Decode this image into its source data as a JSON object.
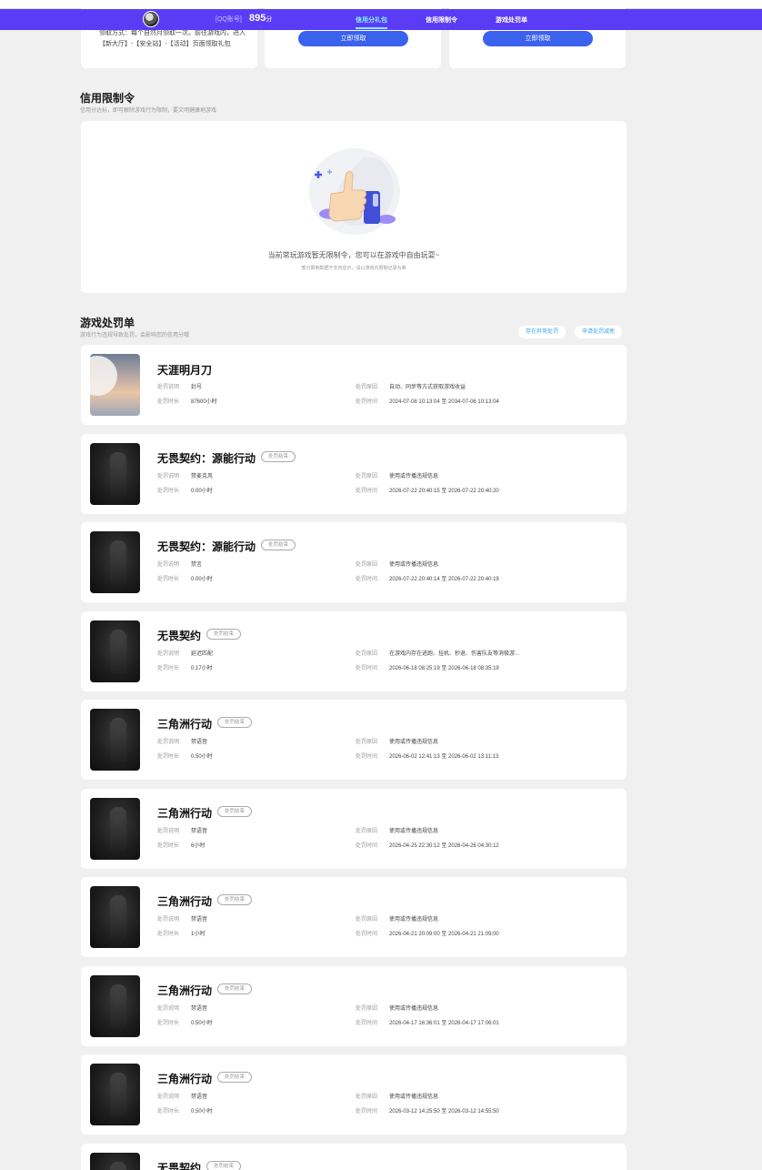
{
  "header": {
    "account_label": "[QQ账号]",
    "score_value": "895",
    "score_unit": "分",
    "nav": [
      "信用分礼包",
      "信用限制令",
      "游戏处罚单"
    ]
  },
  "gift": {
    "method_text": "领取方式：每个自然月领取一次。前往游戏内，进入【新大厅】-【安全站】-【活动】页面领取礼包",
    "buttons": [
      "立即领取",
      "立即领取"
    ]
  },
  "restriction": {
    "title": "信用限制令",
    "subtitle": "信用分达标，即可解除游戏行为限制，要文明健康地游戏",
    "empty_message": "当前常玩游戏暂无限制令，您可以在游戏中自由玩耍~",
    "empty_note": "部分限制数据不支持显示，请以游戏内限制记录为准"
  },
  "penalty": {
    "title": "游戏处罚单",
    "subtitle": "游戏行为违规导致处罚，会影响您的信用分哦",
    "links": [
      "存在异常处罚",
      "申请处罚减免"
    ],
    "field_labels": {
      "desc": "处罚说明",
      "duration": "处罚时长",
      "reason": "处罚原因",
      "time": "处罚时间"
    },
    "items": [
      {
        "game": "天涯明月刀",
        "badge": "",
        "desc": "封号",
        "duration": "87600小时",
        "reason": "自动、同步等方式获取游戏收益",
        "time": "2024-07-08 10:13:04 至 2034-07-06 10:13:04"
      },
      {
        "game": "无畏契约：源能行动",
        "badge": "处罚结束",
        "desc": "禁麦克风",
        "duration": "0.00小时",
        "reason": "使用或传播违规信息",
        "time": "2026-07-22 20:40:15 至 2026-07-22 20:40:20"
      },
      {
        "game": "无畏契约：源能行动",
        "badge": "处罚结束",
        "desc": "禁言",
        "duration": "0.00小时",
        "reason": "使用或传播违规信息",
        "time": "2026-07-22 20:40:14 至 2026-07-22 20:40:19"
      },
      {
        "game": "无畏契约",
        "badge": "处罚结束",
        "desc": "延迟匹配",
        "duration": "0.17小时",
        "reason": "在游戏内存在逃跑、挂机、秒退、伤害队友等消极游...",
        "time": "2026-06-18 08:25:19 至 2026-06-18 08:35:19"
      },
      {
        "game": "三角洲行动",
        "badge": "处罚结束",
        "desc": "禁语音",
        "duration": "0.50小时",
        "reason": "使用或传播违规信息",
        "time": "2026-06-02 12:41:13 至 2026-06-02 13:11:13"
      },
      {
        "game": "三角洲行动",
        "badge": "处罚结束",
        "desc": "禁语音",
        "duration": "6小时",
        "reason": "使用或传播违规信息",
        "time": "2026-04-25 22:30:12 至 2026-04-26 04:30:12"
      },
      {
        "game": "三角洲行动",
        "badge": "处罚结束",
        "desc": "禁语音",
        "duration": "1小时",
        "reason": "使用或传播违规信息",
        "time": "2026-04-21 20:09:00 至 2026-04-21 21:09:00"
      },
      {
        "game": "三角洲行动",
        "badge": "处罚结束",
        "desc": "禁语音",
        "duration": "0.50小时",
        "reason": "使用或传播违规信息",
        "time": "2026-04-17 16:36:01 至 2026-04-17 17:06:01"
      },
      {
        "game": "三角洲行动",
        "badge": "处罚结束",
        "desc": "禁语音",
        "duration": "0.50小时",
        "reason": "使用或传播违规信息",
        "time": "2026-03-12 14:25:50 至 2026-03-12 14:55:50"
      },
      {
        "game": "无畏契约",
        "badge": "处罚结束",
        "desc": "",
        "duration": "",
        "reason": "",
        "time": ""
      }
    ]
  }
}
